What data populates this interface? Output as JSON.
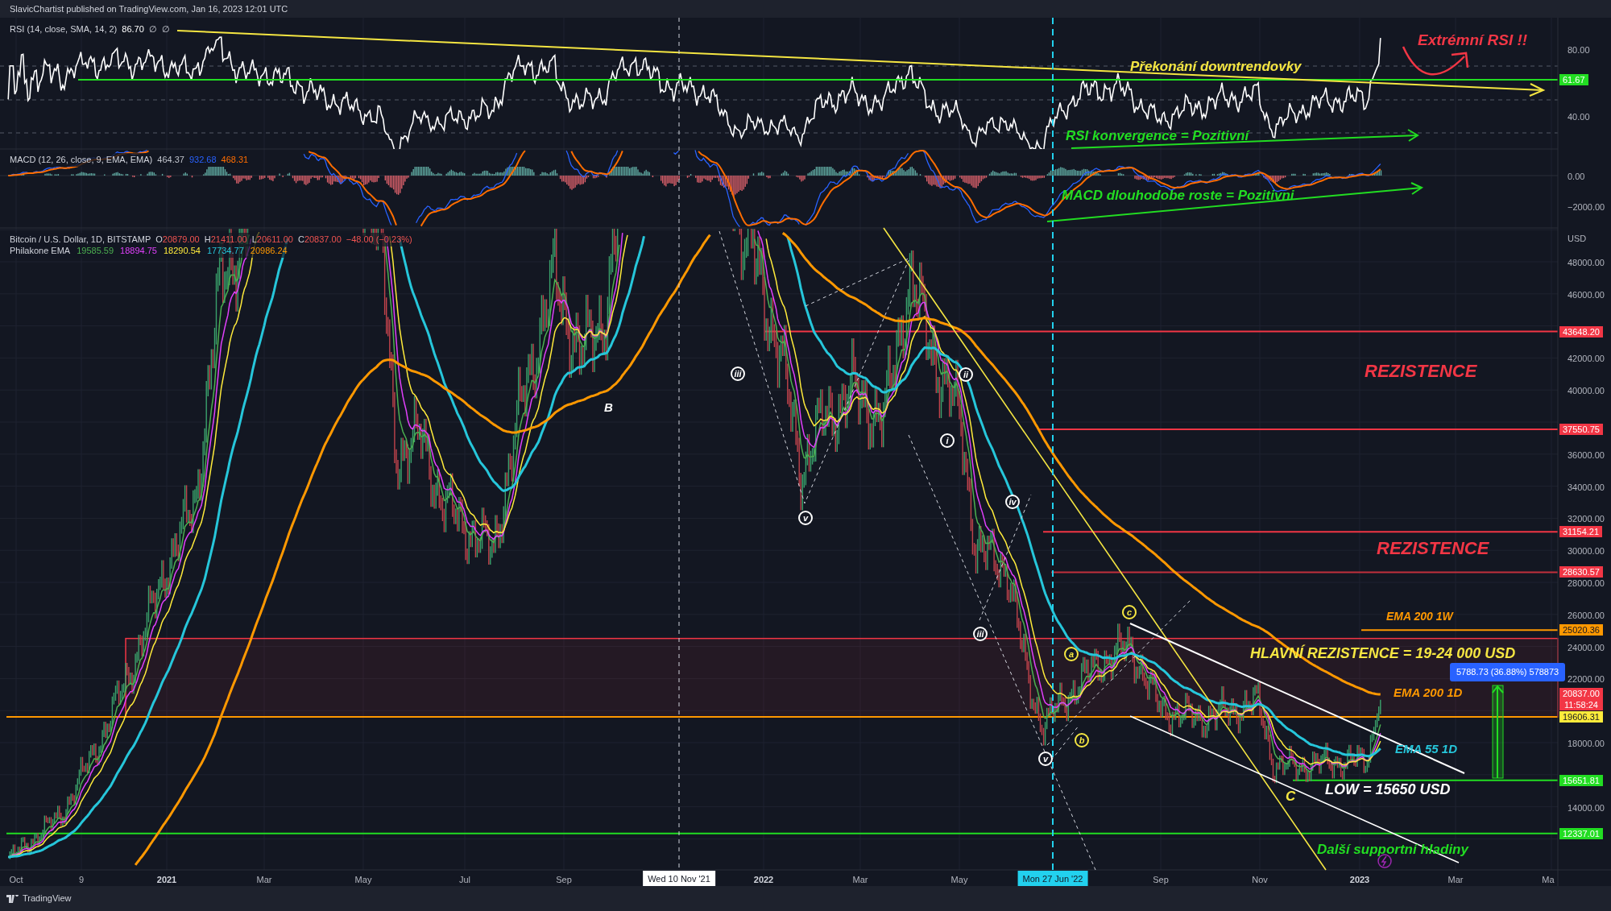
{
  "header": "SlavicChartist published on TradingView.com, Jan 16, 2023 12:01 UTC",
  "rsi": {
    "legend_title": "RSI (14, close, SMA, 14, 2)",
    "legend_value": "86.70",
    "legend_extras": [
      "∅",
      "∅"
    ],
    "ticks": [
      "80.00",
      "40.00"
    ],
    "badges": [
      {
        "lines": [
          "61.67"
        ],
        "color": "#22dd22"
      }
    ],
    "annotations": [
      {
        "text": "Extrémní RSI !!",
        "color": "#f23645"
      },
      {
        "text": "Překonání downtrendovky",
        "color": "#f5e642"
      },
      {
        "text": "RSI konvergence = Pozitivní",
        "color": "#22dd22"
      }
    ]
  },
  "macd": {
    "legend_title": "MACD (12, 26, close, 9, EMA, EMA)",
    "legend_values": [
      {
        "text": "464.37",
        "color": "#c0c4cc"
      },
      {
        "text": "932.68",
        "color": "#2962ff"
      },
      {
        "text": "468.31",
        "color": "#ff6d00"
      }
    ],
    "ticks": [
      "0.00",
      "−2000.00"
    ],
    "annotations": [
      {
        "text": "MACD dlouhodobe roste = Pozitivni",
        "color": "#22dd22"
      }
    ]
  },
  "price": {
    "legend_title": "Bitcoin / U.S. Dollar, 1D, BITSTAMP",
    "ohlc": [
      {
        "label": "O",
        "value": "20879.00"
      },
      {
        "label": "H",
        "value": "21411.00"
      },
      {
        "label": "L",
        "value": "20611.00"
      },
      {
        "label": "C",
        "value": "20837.00"
      }
    ],
    "change": "−48.00 (−0.23%)",
    "ema_title": "Philakone EMA",
    "ema_values": [
      {
        "text": "19585.59",
        "color": "#4caf50"
      },
      {
        "text": "18894.75",
        "color": "#e040fb"
      },
      {
        "text": "18290.54",
        "color": "#ffeb3b"
      },
      {
        "text": "17734.77",
        "color": "#26c6da"
      },
      {
        "text": "20986.24",
        "color": "#ff9800"
      }
    ],
    "unit": "USD",
    "ticks": [
      "48000.00",
      "46000.00",
      "42000.00",
      "40000.00",
      "36000.00",
      "34000.00",
      "32000.00",
      "30000.00",
      "28000.00",
      "26000.00",
      "24000.00",
      "22000.00",
      "18000.00",
      "14000.00"
    ],
    "badges": [
      {
        "lines": [
          "43648.20"
        ],
        "color": "#f23645"
      },
      {
        "lines": [
          "37550.75"
        ],
        "color": "#f23645"
      },
      {
        "lines": [
          "31154.21"
        ],
        "color": "#f23645"
      },
      {
        "lines": [
          "28630.57"
        ],
        "color": "#f23645"
      },
      {
        "lines": [
          "25020.36"
        ],
        "color": "#ff9800"
      },
      {
        "lines": [
          "20837.00",
          "11:58:24"
        ],
        "color": "#f23645"
      },
      {
        "lines": [
          "19606.31"
        ],
        "color": "#ffeb3b"
      },
      {
        "lines": [
          "15651.81"
        ],
        "color": "#22dd22"
      },
      {
        "lines": [
          "12337.01"
        ],
        "color": "#22dd22"
      }
    ],
    "annotations": [
      {
        "text": "REZISTENCE",
        "color": "#f23645"
      },
      {
        "text": "REZISTENCE",
        "color": "#f23645"
      },
      {
        "text": "EMA 200 1W",
        "color": "#ff9800"
      },
      {
        "text": "HLAVNÍ REZISTENCE = 19-24 000 USD",
        "color": "#f5e642"
      },
      {
        "text": "EMA 200 1D",
        "color": "#ff9800"
      },
      {
        "text": "EMA 55 1D",
        "color": "#26c6da"
      },
      {
        "text": "LOW = 15650 USD",
        "color": "#ffffff"
      },
      {
        "text": "C",
        "color": "#f5e642"
      },
      {
        "text": "Další supportní hladiny",
        "color": "#22dd22"
      },
      {
        "text": "B",
        "color": "#ffffff"
      }
    ],
    "wave_labels": [
      {
        "text": "iii",
        "color": "#ffffff"
      },
      {
        "text": "v",
        "color": "#ffffff"
      },
      {
        "text": "i",
        "color": "#ffffff"
      },
      {
        "text": "ii",
        "color": "#ffffff"
      },
      {
        "text": "iv",
        "color": "#ffffff"
      },
      {
        "text": "iii",
        "color": "#ffffff"
      },
      {
        "text": "v",
        "color": "#ffffff"
      },
      {
        "text": "a",
        "color": "#f5e642"
      },
      {
        "text": "b",
        "color": "#f5e642"
      },
      {
        "text": "c",
        "color": "#f5e642"
      }
    ],
    "measure_label": "5788.73 (36.88%) 578873"
  },
  "time_axis": {
    "labels": [
      {
        "text": "Oct",
        "kind": "month"
      },
      {
        "text": "9",
        "kind": "month"
      },
      {
        "text": "2021",
        "kind": "year"
      },
      {
        "text": "Mar",
        "kind": "month"
      },
      {
        "text": "May",
        "kind": "month"
      },
      {
        "text": "Jul",
        "kind": "month"
      },
      {
        "text": "Sep",
        "kind": "month"
      },
      {
        "text": "2022",
        "kind": "year"
      },
      {
        "text": "Mar",
        "kind": "month"
      },
      {
        "text": "May",
        "kind": "month"
      },
      {
        "text": "Sep",
        "kind": "month"
      },
      {
        "text": "Nov",
        "kind": "month"
      },
      {
        "text": "2023",
        "kind": "year"
      },
      {
        "text": "Mar",
        "kind": "month"
      },
      {
        "text": "Ma",
        "kind": "month"
      }
    ],
    "crosshairs": [
      {
        "text": "Wed 10 Nov '21",
        "color": "#ffffff"
      },
      {
        "text": "Mon 27 Jun '22",
        "color": "#22d1ee"
      }
    ]
  },
  "footer": "TradingView"
}
